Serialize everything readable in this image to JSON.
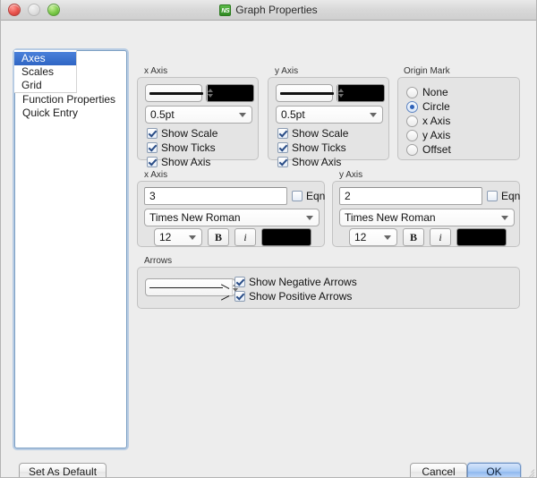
{
  "window": {
    "title": "Graph Properties",
    "app_icon_text": "NS",
    "traffic_lights": [
      "close",
      "minimize",
      "zoom"
    ]
  },
  "sidebar": {
    "items": [
      {
        "label": "Axes",
        "selected": true
      },
      {
        "label": "Scales",
        "selected": false
      },
      {
        "label": "Grid",
        "selected": false
      },
      {
        "label": "Function Properties",
        "selected": false
      },
      {
        "label": "Quick Entry",
        "selected": false
      }
    ]
  },
  "x_axis_style": {
    "group_label": "x Axis",
    "line_style_value": "solid-line",
    "color": "#000000",
    "width_value": "0.5pt",
    "checks": [
      {
        "label": "Show Scale",
        "checked": true
      },
      {
        "label": "Show Ticks",
        "checked": true
      },
      {
        "label": "Show Axis",
        "checked": true
      }
    ]
  },
  "y_axis_style": {
    "group_label": "y Axis",
    "line_style_value": "solid-line",
    "color": "#000000",
    "width_value": "0.5pt",
    "checks": [
      {
        "label": "Show Scale",
        "checked": true
      },
      {
        "label": "Show Ticks",
        "checked": true
      },
      {
        "label": "Show Axis",
        "checked": true
      }
    ]
  },
  "origin_mark": {
    "group_label": "Origin Mark",
    "options": [
      {
        "label": "None",
        "selected": false
      },
      {
        "label": "Circle",
        "selected": true
      },
      {
        "label": "x Axis",
        "selected": false
      },
      {
        "label": "y Axis",
        "selected": false
      },
      {
        "label": "Offset",
        "selected": false
      }
    ]
  },
  "x_axis_label": {
    "group_label": "x Axis",
    "value": "3",
    "placeholder": "",
    "eqn_label": "Eqn",
    "eqn_checked": false,
    "font": "Times New Roman",
    "size": "12",
    "bold_label": "B",
    "italic_label": "i",
    "color": "#000000"
  },
  "y_axis_label": {
    "group_label": "y Axis",
    "value": "2",
    "placeholder": "",
    "eqn_label": "Eqn",
    "eqn_checked": false,
    "font": "Times New Roman",
    "size": "12",
    "bold_label": "B",
    "italic_label": "i",
    "color": "#000000"
  },
  "arrows": {
    "group_label": "Arrows",
    "style_value": "arrow-right",
    "checks": [
      {
        "label": "Show Negative Arrows",
        "checked": true
      },
      {
        "label": "Show Positive Arrows",
        "checked": true
      }
    ]
  },
  "footer": {
    "set_as_default": "Set As Default",
    "cancel": "Cancel",
    "ok": "OK"
  },
  "colors": {
    "accent": "#3b6ecb",
    "window_bg": "#ededed",
    "group_bg": "#e4e4e4"
  }
}
